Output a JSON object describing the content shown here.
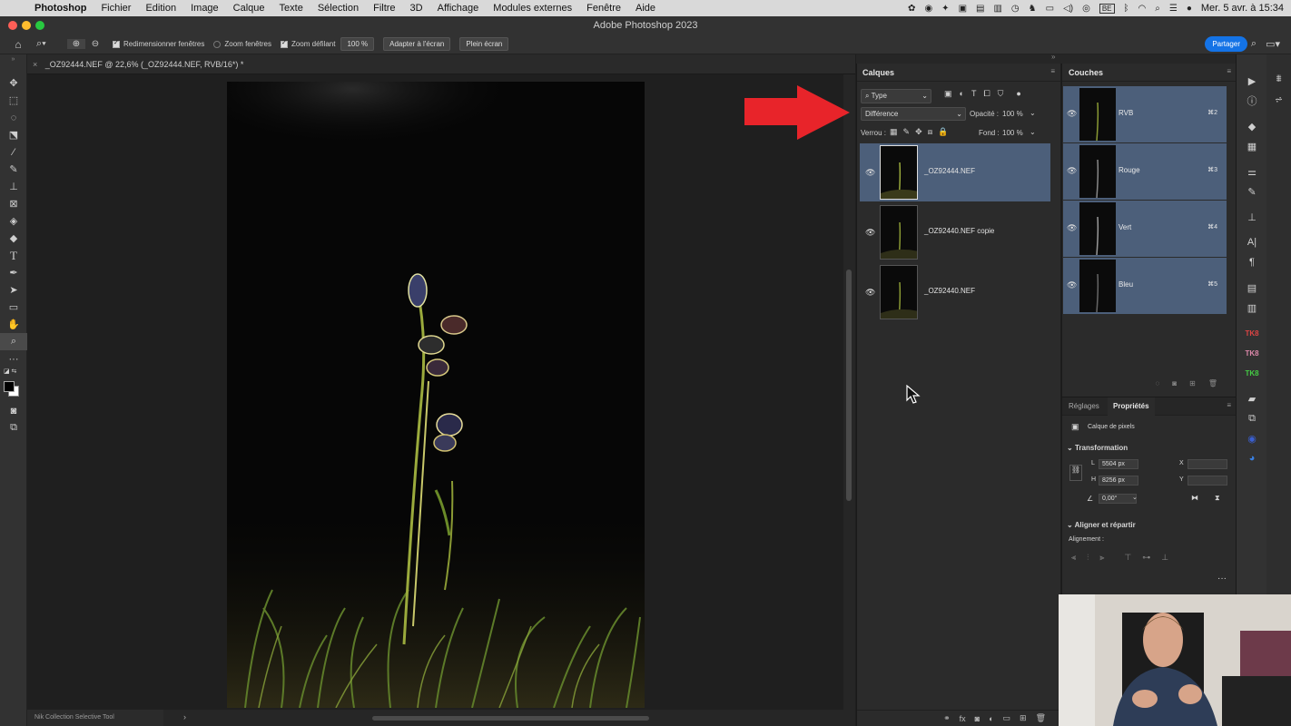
{
  "menubar": {
    "app": "Photoshop",
    "items": [
      "Fichier",
      "Edition",
      "Image",
      "Calque",
      "Texte",
      "Sélection",
      "Filtre",
      "3D",
      "Affichage",
      "Modules externes",
      "Fenêtre",
      "Aide"
    ],
    "keyboard": "BE",
    "datetime": "Mer. 5 avr. à 15:34"
  },
  "window": {
    "title": "Adobe Photoshop 2023"
  },
  "options": {
    "resize_windows": "Redimensionner fenêtres",
    "zoom_windows": "Zoom fenêtres",
    "scrubby_zoom": "Zoom défilant",
    "zoom_value": "100 %",
    "fit_screen": "Adapter à l'écran",
    "fill_screen": "Plein écran",
    "share": "Partager"
  },
  "document": {
    "tab_title": "_OZ92444.NEF @ 22,6% (_OZ92444.NEF, RVB/16*) *",
    "status_text": "Nik Collection Selective Tool"
  },
  "layers_panel": {
    "title": "Calques",
    "filter_type": "Type",
    "blend_mode": "Différence",
    "opacity_label": "Opacité :",
    "opacity_value": "100 %",
    "lock_label": "Verrou :",
    "fill_label": "Fond :",
    "fill_value": "100 %",
    "layers": [
      {
        "name": "_OZ92444.NEF",
        "selected": true
      },
      {
        "name": "_OZ92440.NEF copie",
        "selected": false
      },
      {
        "name": "_OZ92440.NEF",
        "selected": false
      }
    ]
  },
  "channels_panel": {
    "title": "Couches",
    "channels": [
      {
        "name": "RVB",
        "shortcut": "⌘2"
      },
      {
        "name": "Rouge",
        "shortcut": "⌘3"
      },
      {
        "name": "Vert",
        "shortcut": "⌘4"
      },
      {
        "name": "Bleu",
        "shortcut": "⌘5"
      }
    ]
  },
  "properties_panel": {
    "tab_adjustments": "Réglages",
    "tab_properties": "Propriétés",
    "layer_kind": "Calque de pixels",
    "transform_title": "Transformation",
    "w_label": "L",
    "w_value": "5504 px",
    "h_label": "H",
    "h_value": "8256 px",
    "x_label": "X",
    "y_label": "Y",
    "angle_value": "0,00°",
    "align_title": "Aligner et répartir",
    "align_label": "Alignement :"
  },
  "colors": {
    "accent": "#1473e6",
    "selection": "#4c5f7a",
    "arrow": "#e8242a"
  },
  "annotation": {
    "arrow": "red-arrow pointing to blend mode"
  }
}
